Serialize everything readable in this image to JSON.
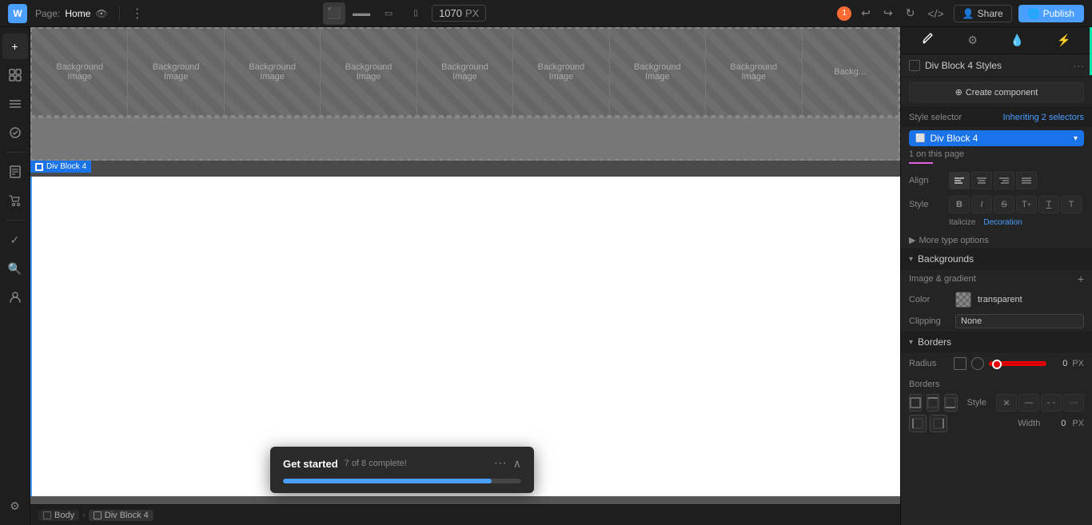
{
  "topbar": {
    "logo": "W",
    "page_label": "Page:",
    "page_name": "Home",
    "width_value": "1070",
    "width_unit": "PX",
    "share_label": "Share",
    "publish_label": "Publish",
    "badge_count": "1",
    "devices": [
      {
        "id": "desktop-large",
        "icon": "⬛",
        "active": true
      },
      {
        "id": "desktop",
        "icon": "▬",
        "active": false
      },
      {
        "id": "tablet-landscape",
        "icon": "▭",
        "active": false
      },
      {
        "id": "tablet",
        "icon": "▯",
        "active": false
      }
    ]
  },
  "canvas": {
    "bg_tiles": [
      {
        "label": "Background\nImage"
      },
      {
        "label": "Background\nImage"
      },
      {
        "label": "Background\nImage"
      },
      {
        "label": "Background\nImage"
      },
      {
        "label": "Background\nImage"
      },
      {
        "label": "Background\nImage"
      },
      {
        "label": "Background\nImage"
      },
      {
        "label": "Background\nImage"
      },
      {
        "label": "Backg..."
      }
    ],
    "div_block_label": "Div Block 4"
  },
  "breadcrumb": {
    "items": [
      {
        "label": "Body",
        "has_checkbox": true
      },
      {
        "label": "Div Block 4",
        "has_checkbox": true
      }
    ]
  },
  "right_panel": {
    "tabs": [
      {
        "icon": "✏️",
        "id": "style",
        "active": true
      },
      {
        "icon": "⚙",
        "id": "settings",
        "active": false
      },
      {
        "icon": "💧",
        "id": "interactions",
        "active": false
      },
      {
        "icon": "⚡",
        "id": "animations",
        "active": false
      }
    ],
    "div_block_styles_label": "Div Block 4 Styles",
    "create_component_label": "Create component",
    "style_selector": {
      "label": "Style selector",
      "value": "Inheriting 2 selectors",
      "element_label": "Div Block 4"
    },
    "on_page": "1 on this page",
    "align": {
      "label": "Align",
      "buttons": [
        "≡",
        "≡",
        "≡",
        "≡"
      ]
    },
    "style": {
      "label": "Style",
      "buttons": [
        "I",
        "I",
        "✕",
        "T̶",
        "T̲",
        "T"
      ],
      "names": [
        "Italicize",
        "Decoration"
      ]
    },
    "more_type": "More type options",
    "backgrounds": {
      "title": "Backgrounds",
      "image_gradient_label": "Image & gradient",
      "color_label": "Color",
      "color_value": "transparent",
      "clipping_label": "Clipping",
      "clipping_value": "None"
    },
    "borders": {
      "title": "Borders",
      "radius_label": "Radius",
      "radius_value": "0",
      "radius_unit": "PX",
      "borders_label": "Borders",
      "style_label": "Style",
      "width_label": "Width",
      "width_value": "0",
      "width_unit": "PX"
    }
  },
  "get_started": {
    "title": "Get started",
    "progress_text": "7 of 8 complete!",
    "progress_percent": 87.5
  }
}
